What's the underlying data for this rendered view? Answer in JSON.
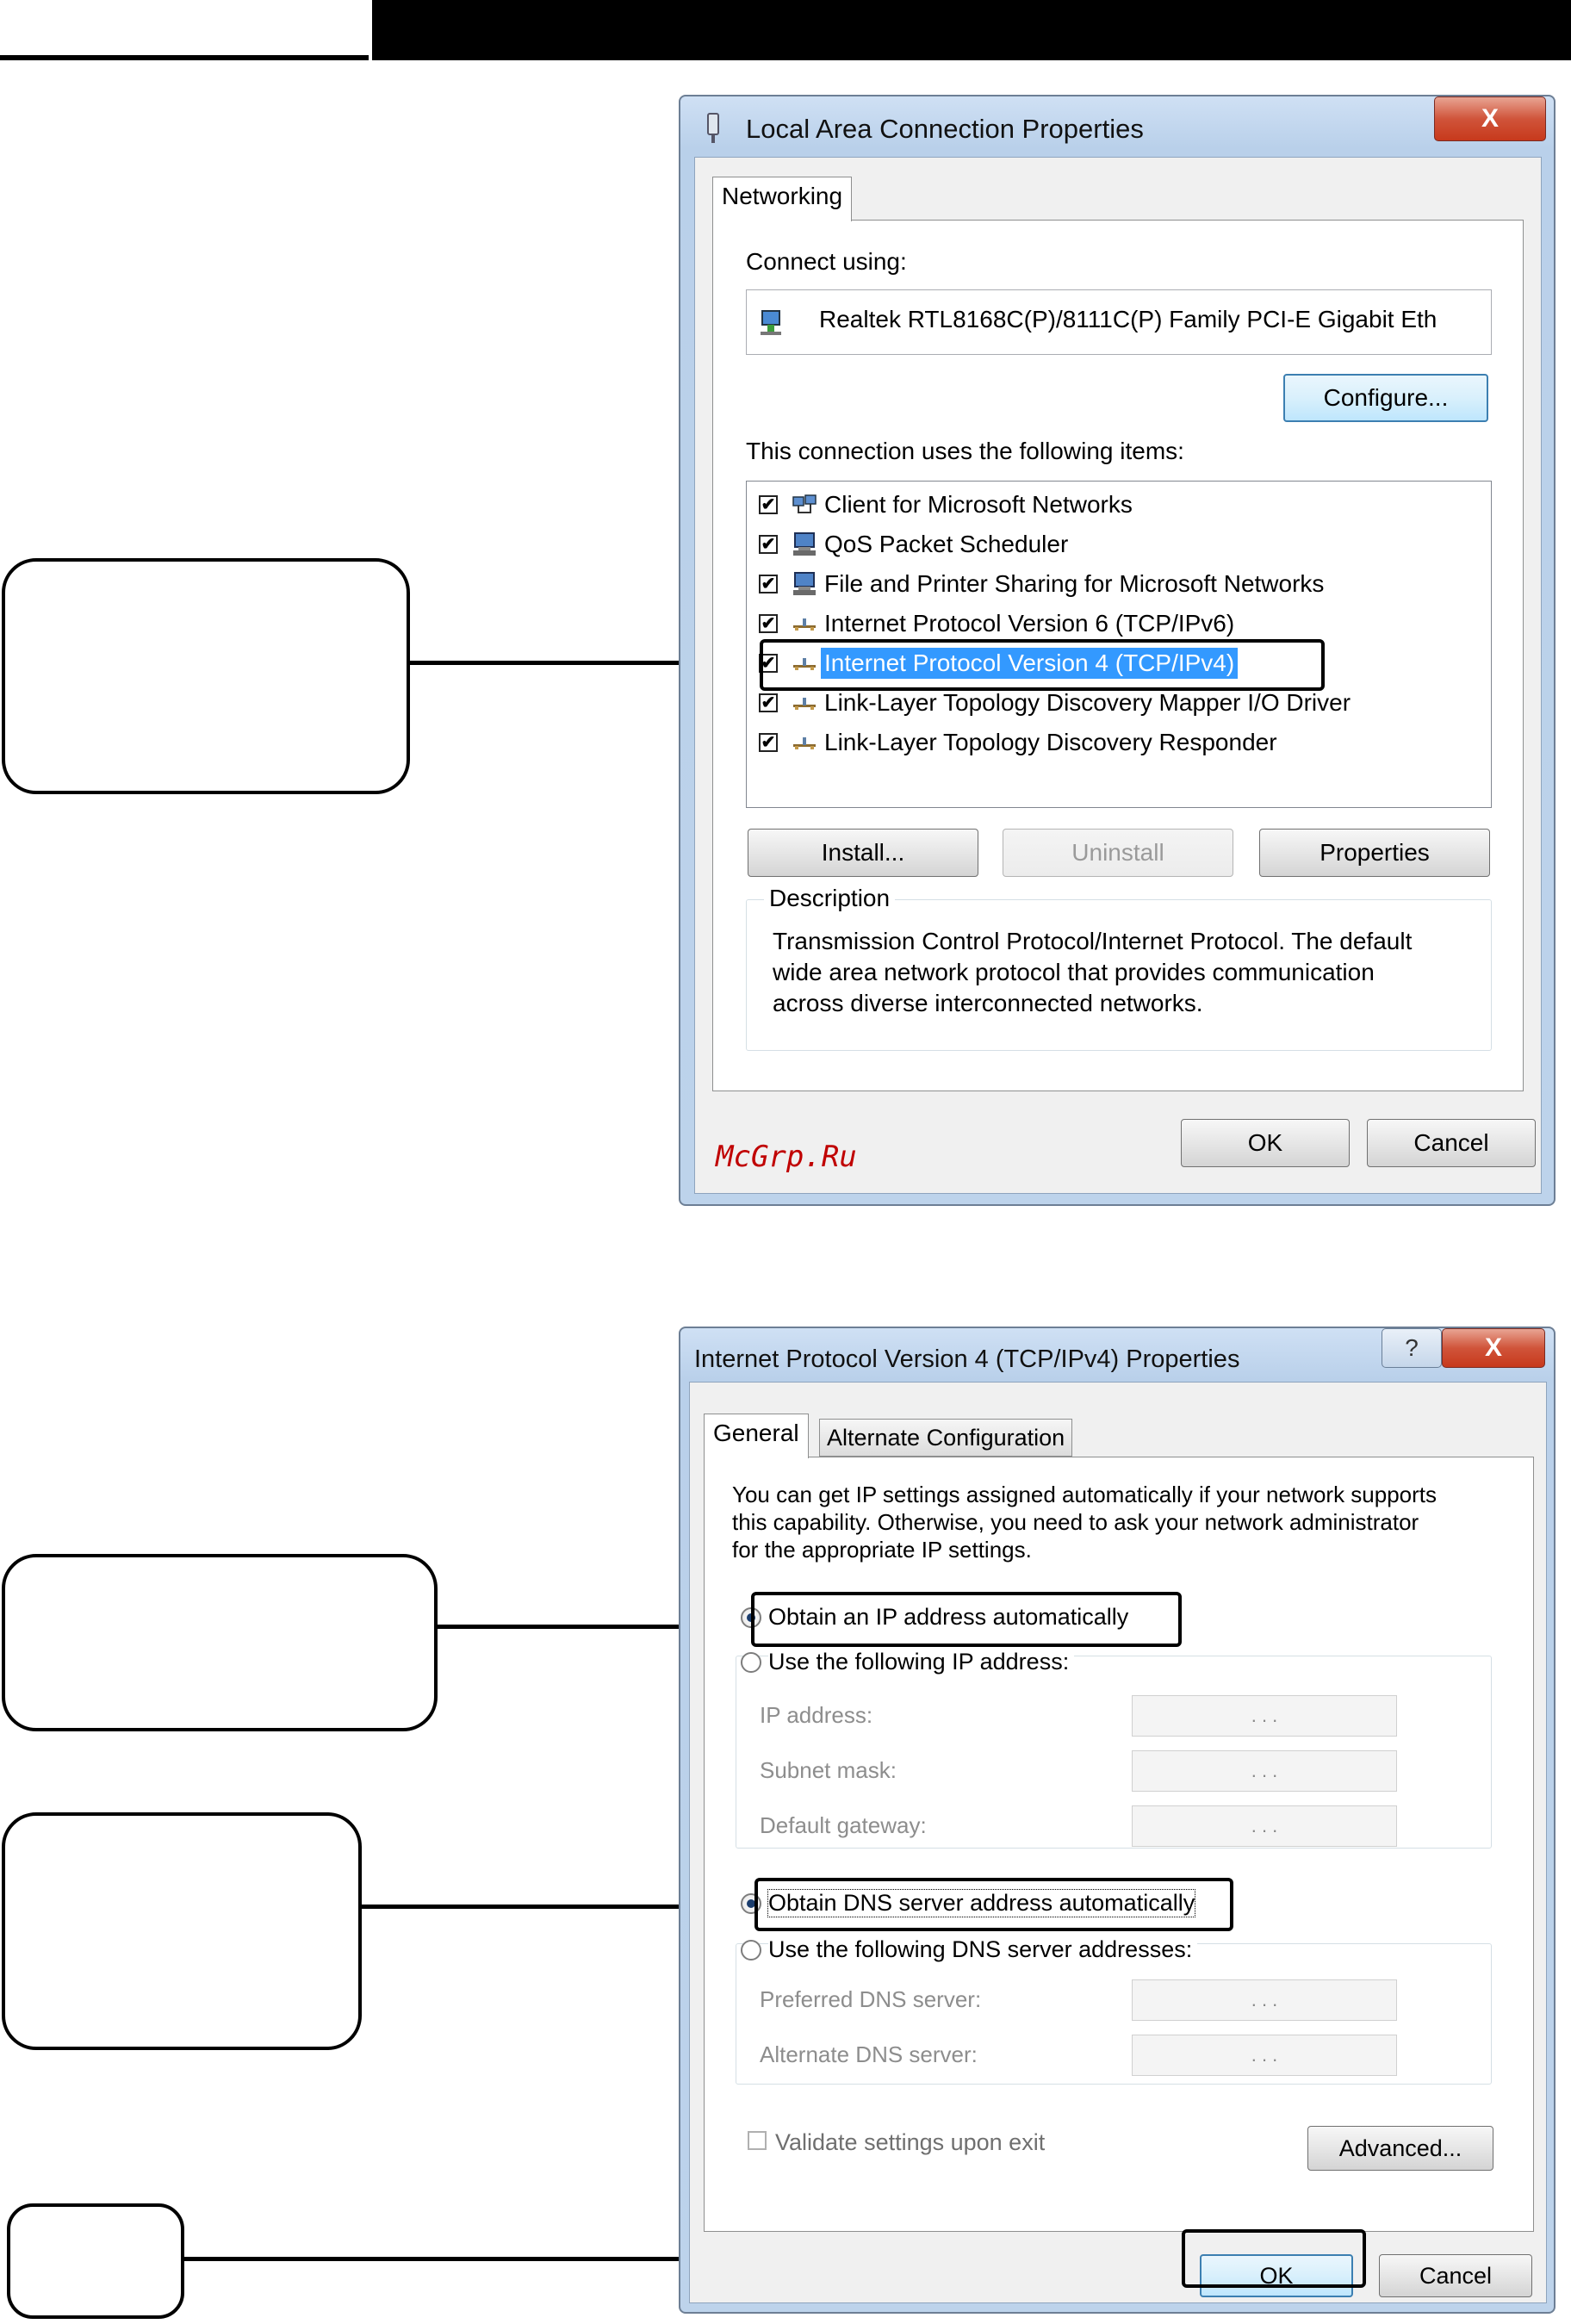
{
  "dialog1": {
    "title": "Local Area Connection Properties",
    "close_label": "X",
    "tab": "Networking",
    "connect_using_label": "Connect using:",
    "adapter_name": "Realtek RTL8168C(P)/8111C(P) Family PCI-E Gigabit Eth",
    "configure_button": "Configure...",
    "items_label": "This connection uses the following items:",
    "items": [
      {
        "label": "Client for Microsoft Networks",
        "checked": true,
        "icon": "network-client-icon"
      },
      {
        "label": "QoS Packet Scheduler",
        "checked": true,
        "icon": "computer-service-icon"
      },
      {
        "label": "File and Printer Sharing for Microsoft Networks",
        "checked": true,
        "icon": "computer-service-icon"
      },
      {
        "label": "Internet Protocol Version 6 (TCP/IPv6)",
        "checked": true,
        "icon": "protocol-icon"
      },
      {
        "label": "Internet Protocol Version 4 (TCP/IPv4)",
        "checked": true,
        "icon": "protocol-icon",
        "selected": true
      },
      {
        "label": "Link-Layer Topology Discovery Mapper I/O Driver",
        "checked": true,
        "icon": "protocol-icon"
      },
      {
        "label": "Link-Layer Topology Discovery Responder",
        "checked": true,
        "icon": "protocol-icon"
      }
    ],
    "install_button": "Install...",
    "uninstall_button": "Uninstall",
    "properties_button": "Properties",
    "description_label": "Description",
    "description_lines": [
      "Transmission Control Protocol/Internet Protocol. The default",
      "wide area network protocol that provides communication",
      "across diverse interconnected networks."
    ],
    "ok_button": "OK",
    "cancel_button": "Cancel",
    "watermark": "McGrp.Ru"
  },
  "dialog2": {
    "title": "Internet Protocol Version 4 (TCP/IPv4) Properties",
    "help_label": "?",
    "close_label": "X",
    "tabs": [
      "General",
      "Alternate Configuration"
    ],
    "intro_lines": [
      "You can get IP settings assigned automatically if your network supports",
      "this capability. Otherwise, you need to ask your network administrator",
      "for the appropriate IP settings."
    ],
    "obtain_ip_auto": "Obtain an IP address automatically",
    "use_following_ip": "Use the following IP address:",
    "ip_address_label": "IP address:",
    "subnet_mask_label": "Subnet mask:",
    "default_gateway_label": "Default gateway:",
    "obtain_dns_auto": "Obtain DNS server address automatically",
    "use_following_dns": "Use the following DNS server addresses:",
    "preferred_dns_label": "Preferred DNS server:",
    "alternate_dns_label": "Alternate DNS server:",
    "ip_placeholder_dots": ".    .    .",
    "validate_label": "Validate settings upon exit",
    "advanced_button": "Advanced...",
    "ok_button": "OK",
    "cancel_button": "Cancel"
  }
}
